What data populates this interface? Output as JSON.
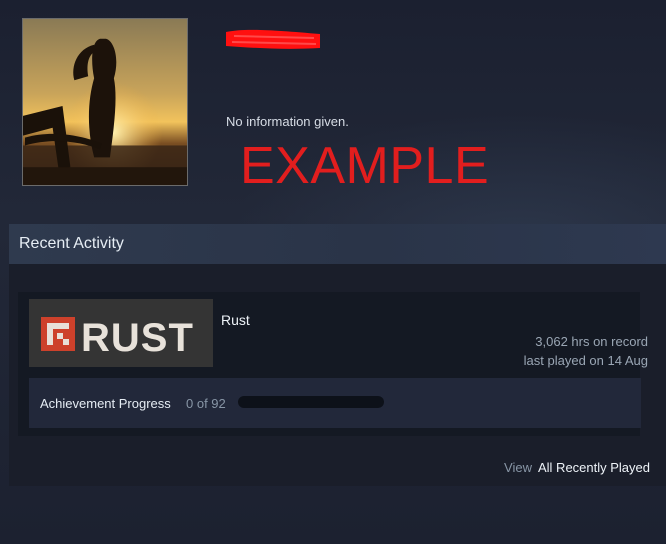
{
  "profile": {
    "summary": "No information given.",
    "overlay_text": "EXAMPLE"
  },
  "recent_activity": {
    "title": "Recent Activity",
    "games": [
      {
        "name": "Rust",
        "logo_text": "RUST",
        "hours_on_record": "3,062 hrs on record",
        "last_played": "last played on 14 Aug",
        "achievement_label": "Achievement Progress",
        "achievement_count": "0 of 92",
        "achievement_fraction": 0
      }
    ],
    "view_word": "View",
    "view_link": "All Recently Played"
  },
  "colors": {
    "overlay_red": "#e21e1e",
    "rust_orange": "#cd412b",
    "accent_blue": "#5aa9e6"
  }
}
